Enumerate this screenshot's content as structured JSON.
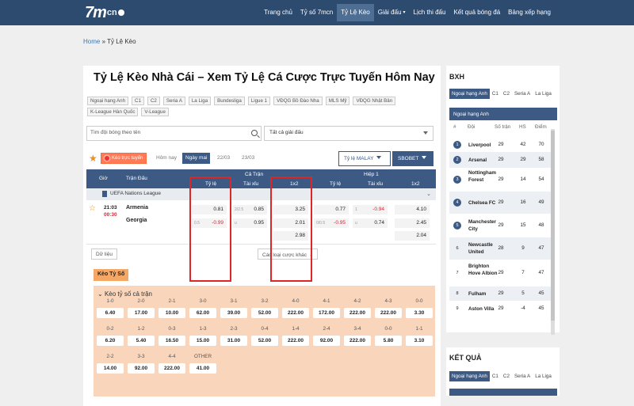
{
  "header": {
    "logo_text": "7m",
    "logo_sub": "cn",
    "nav": [
      "Trang chủ",
      "Tỷ số 7mcn",
      "Tỷ Lệ Kèo",
      "Giải đấu",
      "Lịch thi đấu",
      "Kết quả bóng đá",
      "Bảng xếp hạng"
    ]
  },
  "breadcrumb": {
    "home": "Home",
    "sep": "»",
    "current": "Tỷ Lệ Kèo"
  },
  "page_title": "Tỷ Lệ Kèo Nhà Cái – Xem Tỷ Lệ Cá Cược Trực Tuyến Hôm Nay",
  "league_tags": [
    "Ngoại hạng Anh",
    "C1",
    "C2",
    "Seria A",
    "La Liga",
    "Bundesliga",
    "Ligue 1",
    "VĐQG Bồ Đào Nha",
    "MLS Mỹ",
    "VĐQG Nhật Bản",
    "K-League Hàn Quốc",
    "V-League"
  ],
  "search": {
    "placeholder": "Tìm đội bóng theo tên"
  },
  "league_select": "Tất cả giải đấu",
  "filters": {
    "live": "Kèo trực tuyến",
    "today": "Hôm nay",
    "tomorrow": "Ngày mai",
    "d1": "22/03",
    "d2": "23/03",
    "odds_type": "Tỷ lệ MALAY",
    "bookmaker": "SBOBET"
  },
  "table": {
    "col_time": "Giờ",
    "col_match": "Trận Đấu",
    "full": "Cả Trận",
    "half": "Hiệp 1",
    "sub": [
      "Tỷ lệ",
      "Tài xỉu",
      "1x2",
      "Tỷ lệ",
      "Tài xỉu",
      "1x2"
    ],
    "league": "UEFA Nations League",
    "match": {
      "time": "21:03",
      "clock": "00:30",
      "home": "Armenia",
      "away": "Georgia",
      "ft_hcp_h": "0.81",
      "ft_hcp_line": "0.5",
      "ft_hcp_a": "-0.99",
      "ft_ou_line": "2/2.5",
      "ft_ou_o": "0.85",
      "ft_ou_u_line": "u",
      "ft_ou_u": "0.95",
      "ft_1x2": [
        "3.25",
        "2.01",
        "2.98"
      ],
      "h1_hcp_h": "0.77",
      "h1_hcp_line": "0/0.5",
      "h1_hcp_a": "-0.95",
      "h1_ou_line": "1",
      "h1_ou_o": "-0.94",
      "h1_ou_u_line": "u",
      "h1_ou_u": "0.74",
      "h1_1x2": [
        "4.10",
        "2.45",
        "2.04"
      ]
    },
    "data_btn": "Dữ liệu",
    "more_btn": "Các loại cược khác"
  },
  "score_section": {
    "tab": "Kèo Tỷ Số",
    "title": "Kèo tỷ số cả trận",
    "rows": [
      {
        "labels": [
          "1-0",
          "2-0",
          "2-1",
          "3-0",
          "3-1",
          "3-2",
          "4-0",
          "4-1",
          "4-2",
          "4-3",
          "0-0"
        ],
        "values": [
          "6.40",
          "17.00",
          "10.00",
          "62.00",
          "39.00",
          "52.00",
          "222.00",
          "172.00",
          "222.00",
          "222.00",
          "3.30"
        ]
      },
      {
        "labels": [
          "0-2",
          "1-2",
          "0-3",
          "1-3",
          "2-3",
          "0-4",
          "1-4",
          "2-4",
          "3-4",
          "0-0",
          "1-1"
        ],
        "values": [
          "6.20",
          "5.40",
          "16.50",
          "15.00",
          "31.00",
          "52.00",
          "222.00",
          "92.00",
          "222.00",
          "5.80",
          "3.10"
        ]
      },
      {
        "labels": [
          "2-2",
          "3-3",
          "4-4",
          "OTHER"
        ],
        "values": [
          "14.00",
          "92.00",
          "222.00",
          "41.00"
        ]
      }
    ]
  },
  "sidebar": {
    "title": "BXH",
    "tabs": [
      "Ngoại hạng Anh",
      "C1",
      "C2",
      "Seria A",
      "La Liga"
    ],
    "league": "Ngoại hạng Anh",
    "cols": [
      "#",
      "Đội",
      "Số trận",
      "HS",
      "Điểm"
    ],
    "rows": [
      {
        "rank": "1",
        "team": "Liverpool",
        "played": "29",
        "gd": "42",
        "pts": "70"
      },
      {
        "rank": "2",
        "team": "Arsenal",
        "played": "29",
        "gd": "29",
        "pts": "58"
      },
      {
        "rank": "3",
        "team": "Nottingham Forest",
        "played": "29",
        "gd": "14",
        "pts": "54"
      },
      {
        "rank": "4",
        "team": "Chelsea FC",
        "played": "29",
        "gd": "16",
        "pts": "49"
      },
      {
        "rank": "5",
        "team": "Manchester City",
        "played": "29",
        "gd": "15",
        "pts": "48"
      },
      {
        "rank": "6",
        "team": "Newcastle United",
        "played": "28",
        "gd": "9",
        "pts": "47"
      },
      {
        "rank": "7",
        "team": "Brighton Hove Albion",
        "played": "29",
        "gd": "7",
        "pts": "47"
      },
      {
        "rank": "8",
        "team": "Fulham",
        "played": "29",
        "gd": "5",
        "pts": "45"
      },
      {
        "rank": "9",
        "team": "Aston Villa",
        "played": "29",
        "gd": "-4",
        "pts": "45"
      }
    ]
  },
  "results": {
    "title": "KẾT QUẢ",
    "tabs": [
      "Ngoại hạng Anh",
      "C1",
      "C2",
      "Seria A",
      "La Liga"
    ]
  }
}
